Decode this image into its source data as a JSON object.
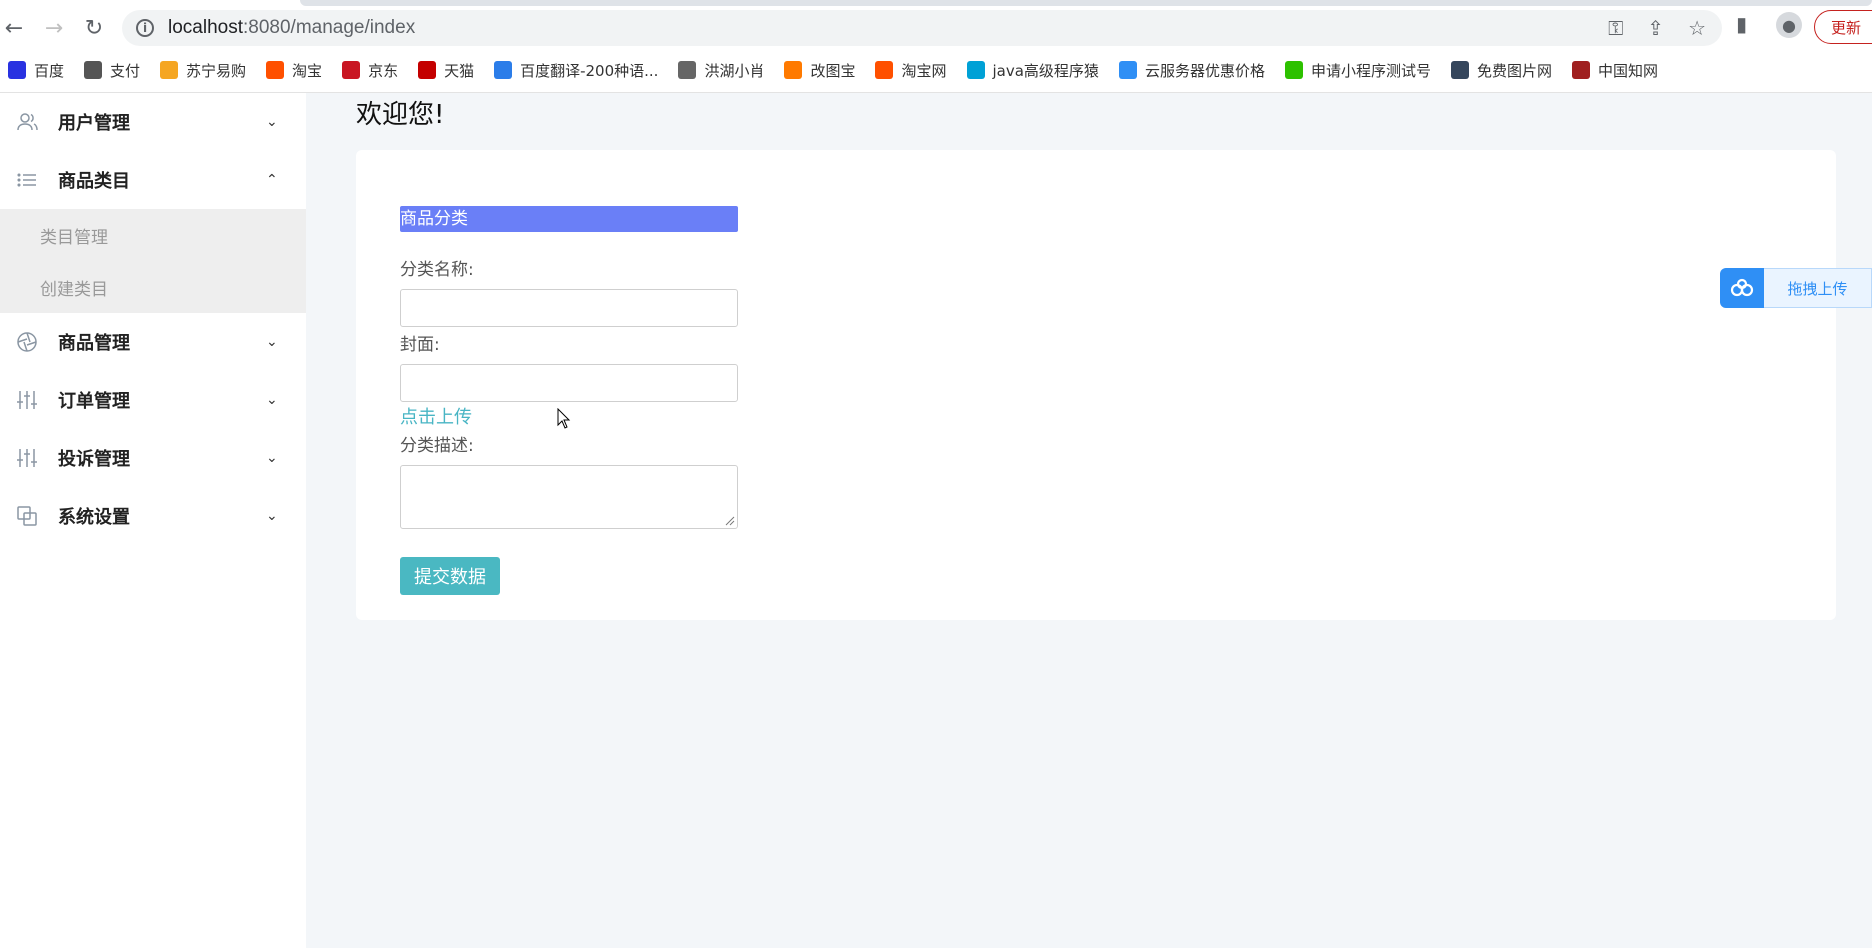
{
  "browser": {
    "url_host": "localhost",
    "url_path": ":8080/manage/index",
    "update_label": "更新",
    "bookmarks": [
      {
        "label": "百度",
        "icon": "baidu-icon",
        "color": "#2932e1"
      },
      {
        "label": "支付",
        "icon": "globe-icon",
        "color": "#555555"
      },
      {
        "label": "苏宁易购",
        "icon": "suning-icon",
        "color": "#f5a623"
      },
      {
        "label": "淘宝",
        "icon": "taobao-icon",
        "color": "#ff5000"
      },
      {
        "label": "京东",
        "icon": "jd-icon",
        "color": "#c91623"
      },
      {
        "label": "天猫",
        "icon": "tmall-icon",
        "color": "#c40000"
      },
      {
        "label": "百度翻译-200种语...",
        "icon": "translate-icon",
        "color": "#2b7de9"
      },
      {
        "label": "洪湖小肖",
        "icon": "bird-icon",
        "color": "#666666"
      },
      {
        "label": "改图宝",
        "icon": "gaitubao-icon",
        "color": "#ff7a00"
      },
      {
        "label": "淘宝网",
        "icon": "taobao-net-icon",
        "color": "#ff5000"
      },
      {
        "label": "java高级程序猿",
        "icon": "bilibili-icon",
        "color": "#00a1d6"
      },
      {
        "label": "云服务器优惠价格",
        "icon": "cloud-icon",
        "color": "#2f8ff5"
      },
      {
        "label": "申请小程序测试号",
        "icon": "wechat-icon",
        "color": "#2dc100"
      },
      {
        "label": "免费图片网",
        "icon": "tumblr-icon",
        "color": "#35465c"
      },
      {
        "label": "中国知网",
        "icon": "cnki-icon",
        "color": "#a02020"
      }
    ]
  },
  "sidebar": {
    "items": [
      {
        "label": "用户管理",
        "icon": "users-icon",
        "expanded": false
      },
      {
        "label": "商品类目",
        "icon": "list-icon",
        "expanded": true,
        "children": [
          "类目管理",
          "创建类目"
        ]
      },
      {
        "label": "商品管理",
        "icon": "aperture-icon",
        "expanded": false
      },
      {
        "label": "订单管理",
        "icon": "sliders-icon",
        "expanded": false
      },
      {
        "label": "投诉管理",
        "icon": "sliders-icon",
        "expanded": false
      },
      {
        "label": "系统设置",
        "icon": "copy-icon",
        "expanded": false
      }
    ]
  },
  "main": {
    "welcome": "欢迎您!",
    "form": {
      "title": "商品分类",
      "name_label": "分类名称:",
      "name_value": "",
      "cover_label": "封面:",
      "cover_value": "",
      "upload_link": "点击上传",
      "desc_label": "分类描述:",
      "desc_value": "",
      "submit_label": "提交数据"
    },
    "drag_upload_label": "拖拽上传"
  }
}
